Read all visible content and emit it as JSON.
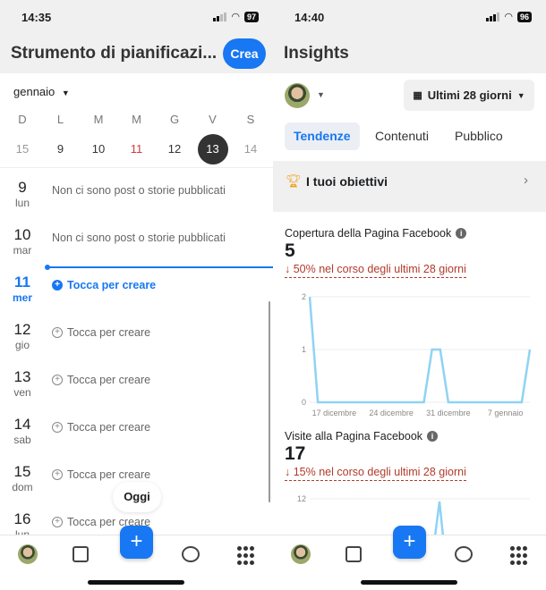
{
  "left": {
    "status": {
      "time": "14:35",
      "battery": "97"
    },
    "title": "Strumento di pianificazi...",
    "create_label": "Crea",
    "month": "gennaio",
    "weekdays": [
      "D",
      "L",
      "M",
      "M",
      "G",
      "V",
      "S"
    ],
    "dates": [
      "15",
      "9",
      "10",
      "11",
      "12",
      "13",
      "14"
    ],
    "selected_date": "13",
    "today_date": "11",
    "rows": [
      {
        "num": "9",
        "day": "lun",
        "text": "Non ci sono post o storie pubblicati"
      },
      {
        "num": "10",
        "day": "mar",
        "text": "Non ci sono post o storie pubblicati"
      },
      {
        "num": "11",
        "day": "mer",
        "text": "Tocca per creare"
      },
      {
        "num": "12",
        "day": "gio",
        "text": "Tocca per creare"
      },
      {
        "num": "13",
        "day": "ven",
        "text": "Tocca per creare"
      },
      {
        "num": "14",
        "day": "sab",
        "text": "Tocca per creare"
      },
      {
        "num": "15",
        "day": "dom",
        "text": "Tocca per creare"
      },
      {
        "num": "16",
        "day": "lun",
        "text": "Tocca per creare"
      }
    ],
    "today_button": "Oggi"
  },
  "right": {
    "status": {
      "time": "14:40",
      "battery": "96"
    },
    "title": "Insights",
    "range": "Ultimi 28 giorni",
    "tabs": [
      "Tendenze",
      "Contenuti",
      "Pubblico"
    ],
    "active_tab": "Tendenze",
    "goals": "I tuoi obiettivi",
    "metrics": [
      {
        "title": "Copertura della Pagina Facebook",
        "value": "5",
        "change": "↓ 50% nel corso degli ultimi 28 giorni"
      },
      {
        "title": "Visite alla Pagina Facebook",
        "value": "17",
        "change": "↓ 15% nel corso degli ultimi 28 giorni"
      }
    ]
  },
  "colors": {
    "accent": "#1877f2",
    "negative": "#b23a2b",
    "line": "#8fd3f4",
    "today": "#d23b3b"
  },
  "chart_data": [
    {
      "type": "line",
      "title": "Copertura della Pagina Facebook",
      "ylim": [
        0,
        2
      ],
      "yticks": [
        "0",
        "1",
        "2"
      ],
      "xticks": [
        "17 dicembre",
        "24 dicembre",
        "31 dicembre",
        "7 gennaio"
      ],
      "x": [
        "14 dic",
        "15 dic",
        "16 dic",
        "17 dic",
        "18 dic",
        "19 dic",
        "20 dic",
        "21 dic",
        "22 dic",
        "23 dic",
        "24 dic",
        "25 dic",
        "26 dic",
        "27 dic",
        "28 dic",
        "29 dic",
        "30 dic",
        "31 dic",
        "1 gen",
        "2 gen",
        "3 gen",
        "4 gen",
        "5 gen",
        "6 gen",
        "7 gen",
        "8 gen",
        "9 gen",
        "10 gen"
      ],
      "values": [
        2,
        0,
        0,
        0,
        0,
        0,
        0,
        0,
        0,
        0,
        0,
        0,
        0,
        0,
        0,
        1,
        1,
        0,
        0,
        0,
        0,
        0,
        0,
        0,
        0,
        0,
        0,
        1
      ],
      "grid": true
    },
    {
      "type": "line",
      "title": "Visite alla Pagina Facebook",
      "yticks": [
        "12"
      ],
      "grid": true
    }
  ]
}
